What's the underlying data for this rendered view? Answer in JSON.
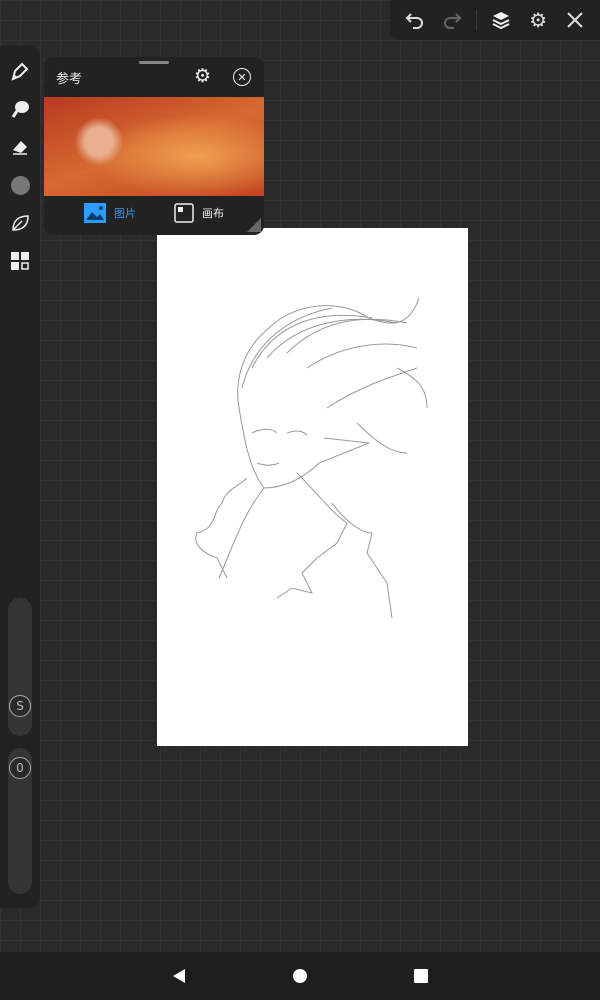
{
  "topbar": {
    "icons": [
      "undo-icon",
      "redo-icon",
      "layers-icon",
      "settings-icon",
      "close-icon"
    ]
  },
  "tools": [
    "brush-icon",
    "smudge-icon",
    "eraser-icon",
    "color-icon",
    "leaf-icon",
    "grid-icon"
  ],
  "sliders": {
    "size_label": "S",
    "opacity_label": "0",
    "size_value": 0.2,
    "opacity_value": 0.85
  },
  "reference": {
    "title": "参考",
    "tab_image": "图片",
    "tab_canvas": "画布",
    "accent": "#2d9cff"
  },
  "nav": [
    "back-icon",
    "home-icon",
    "recents-icon"
  ]
}
